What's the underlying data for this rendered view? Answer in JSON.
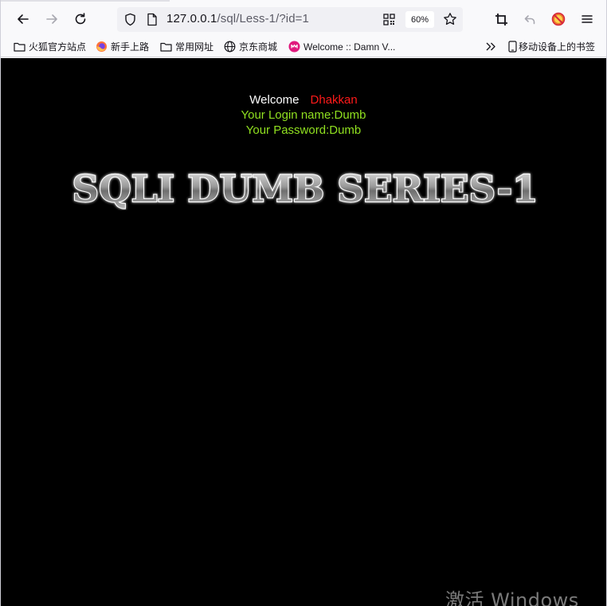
{
  "browser": {
    "url_host": "127.0.0.1",
    "url_path": "/sql/Less-1/?id=1",
    "zoom": "60%"
  },
  "bookmarks": {
    "items": [
      {
        "label": "火狐官方站点",
        "icon": "folder-icon"
      },
      {
        "label": "新手上路",
        "icon": "firefox-icon"
      },
      {
        "label": "常用网址",
        "icon": "folder-icon"
      },
      {
        "label": "京东商城",
        "icon": "globe-icon"
      },
      {
        "label": "Welcome :: Damn V...",
        "icon": "dvwa-icon"
      }
    ],
    "mobile_label": "移动设备上的书签"
  },
  "page": {
    "welcome_label": "Welcome",
    "welcome_name": "Dhakkan",
    "login_line": "Your Login name:Dumb",
    "password_line": "Your Password:Dumb",
    "banner_text": "SQLI DUMB SERIES-1"
  },
  "watermark": "激活 Windows",
  "colors": {
    "background": "#000000",
    "welcome_name": "#ff1a1a",
    "credentials": "#90e020"
  }
}
